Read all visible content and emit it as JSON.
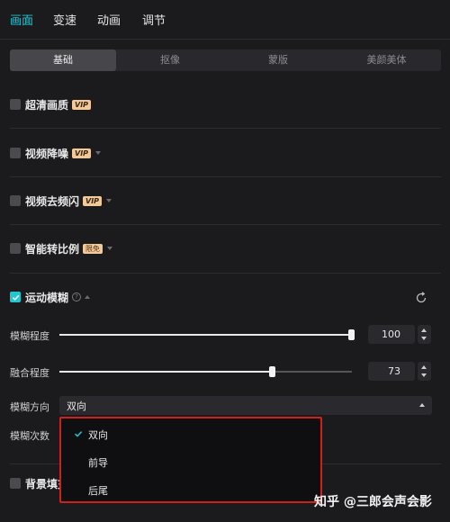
{
  "tabs": [
    {
      "label": "画面",
      "active": true
    },
    {
      "label": "变速",
      "active": false
    },
    {
      "label": "动画",
      "active": false
    },
    {
      "label": "调节",
      "active": false
    }
  ],
  "subtabs": [
    {
      "label": "基础",
      "active": true
    },
    {
      "label": "抠像",
      "active": false
    },
    {
      "label": "蒙版",
      "active": false
    },
    {
      "label": "美颜美体",
      "active": false
    }
  ],
  "sections": {
    "hd": {
      "label": "超清画质",
      "badge": "VIP",
      "checked": false
    },
    "denoise": {
      "label": "视频降噪",
      "badge": "VIP",
      "checked": false
    },
    "deflicker": {
      "label": "视频去频闪",
      "badge": "VIP",
      "checked": false
    },
    "smart_ratio": {
      "label": "智能转比例",
      "badge": "限免",
      "checked": false
    },
    "motion_blur": {
      "label": "运动模糊",
      "checked": true
    },
    "bg_fill": {
      "label": "背景填充",
      "checked": false
    }
  },
  "motion_blur": {
    "blur_label": "模糊程度",
    "blur_value": "100",
    "blur_level": 100,
    "blend_label": "融合程度",
    "blend_value": "73",
    "blend_level": 73,
    "direction_label": "模糊方向",
    "direction_value": "双向",
    "count_label": "模糊次数"
  },
  "dropdown": {
    "options": [
      {
        "label": "双向",
        "selected": true
      },
      {
        "label": "前导",
        "selected": false
      },
      {
        "label": "后尾",
        "selected": false
      }
    ]
  },
  "watermark": "知乎 @三郎会声会影",
  "colors": {
    "accent": "#22c6d1",
    "vip_badge": "#f2c99a",
    "highlight_border": "#d0201e",
    "background": "#1b1b1e"
  }
}
